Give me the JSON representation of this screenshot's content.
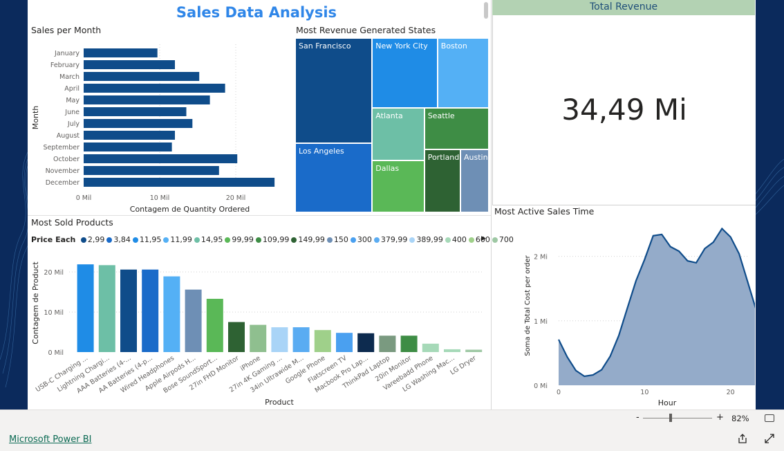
{
  "report": {
    "title": "Sales Data Analysis",
    "colors": {
      "accent": "#2f86e8",
      "canvas": "#0b2a5c",
      "kpi_header": "#b3d2b3"
    }
  },
  "sales_per_month": {
    "title": "Sales per Month",
    "chart_data": {
      "type": "bar",
      "orientation": "horizontal",
      "categories": [
        "January",
        "February",
        "March",
        "April",
        "May",
        "June",
        "July",
        "August",
        "September",
        "October",
        "November",
        "December"
      ],
      "values": [
        9.7,
        12.0,
        15.2,
        18.6,
        16.6,
        13.5,
        14.3,
        12.0,
        11.6,
        20.2,
        17.8,
        25.1
      ],
      "xlabel": "Contagem de Quantity Ordered",
      "ylabel": "Month",
      "xlim": [
        0,
        27
      ],
      "xticks": [
        0,
        10,
        20
      ],
      "xtick_labels": [
        "0 Mil",
        "10 Mil",
        "20 Mil"
      ],
      "color": "#0f4c8a"
    }
  },
  "states": {
    "title": "Most Revenue Generated States",
    "chart_data": {
      "type": "treemap",
      "labels": [
        "San Francisco",
        "Los Angeles",
        "New York City",
        "Boston",
        "Atlanta",
        "Dallas",
        "Seattle",
        "Portland",
        "Austin"
      ],
      "values": [
        8.26,
        5.45,
        4.66,
        3.66,
        2.8,
        2.77,
        2.75,
        2.32,
        1.82
      ],
      "colors": [
        "#0f4c8a",
        "#1a6bc9",
        "#1f8ce6",
        "#54b0f5",
        "#6dbfa6",
        "#5ab857",
        "#3e8d45",
        "#2e6233",
        "#6e8fb5"
      ]
    }
  },
  "kpi": {
    "title": "Total Revenue",
    "value": "34,49 Mi"
  },
  "products": {
    "title": "Most Sold Products",
    "legend": {
      "title": "Price Each",
      "items": [
        {
          "label": "2,99",
          "color": "#0f4c8a"
        },
        {
          "label": "3,84",
          "color": "#1a6bc9"
        },
        {
          "label": "11,95",
          "color": "#1f8ce6"
        },
        {
          "label": "11,99",
          "color": "#54b0f5"
        },
        {
          "label": "14,95",
          "color": "#6dbfa6"
        },
        {
          "label": "99,99",
          "color": "#5ab857"
        },
        {
          "label": "109,99",
          "color": "#3e8d45"
        },
        {
          "label": "149,99",
          "color": "#2e6233"
        },
        {
          "label": "150",
          "color": "#6e8fb5"
        },
        {
          "label": "300",
          "color": "#4aa0f0"
        },
        {
          "label": "379,99",
          "color": "#5aacf2"
        },
        {
          "label": "389,99",
          "color": "#a9d4f7"
        },
        {
          "label": "400",
          "color": "#a6d9b8"
        },
        {
          "label": "600",
          "color": "#9fd08a"
        },
        {
          "label": "700",
          "color": "#9ec8a4"
        }
      ]
    },
    "chart_data": {
      "type": "bar",
      "categories": [
        "USB-C Charging ...",
        "Lightning Chargi...",
        "AAA Batteries (4-...",
        "AA Batteries (4-p...",
        "Wired Headphones",
        "Apple Airpods H...",
        "Bose SoundSport...",
        "27in FHD Monitor",
        "iPhone",
        "27in 4K Gaming ...",
        "34in Ultrawide M...",
        "Google Phone",
        "Flatscreen TV",
        "Macbook Pro Lap...",
        "ThinkPad Laptop",
        "20in Monitor",
        "Vareebadd Phone",
        "LG Washing Mac...",
        "LG Dryer"
      ],
      "values": [
        21.9,
        21.7,
        20.6,
        20.6,
        18.9,
        15.6,
        13.3,
        7.5,
        6.8,
        6.2,
        6.2,
        5.5,
        4.8,
        4.7,
        4.1,
        4.1,
        2.1,
        0.7,
        0.6
      ],
      "colors": [
        "#1f8ce6",
        "#6dbfa6",
        "#0f4c8a",
        "#1a6bc9",
        "#54b0f5",
        "#6e8fb5",
        "#5ab857",
        "#2e6233",
        "#8fbf8f",
        "#a9d4f7",
        "#5aacf2",
        "#9fd08a",
        "#4aa0f0",
        "#0d2b4f",
        "#7a9a80",
        "#3e8d45",
        "#a6d9b8",
        "#a6d9b8",
        "#9ec8a4"
      ],
      "xlabel": "Product",
      "ylabel": "Contagem de Product",
      "ylim": [
        0,
        24
      ],
      "yticks": [
        0,
        10,
        20
      ],
      "ytick_labels": [
        "0 Mil",
        "10 Mil",
        "20 Mil"
      ]
    }
  },
  "sales_time": {
    "title": "Most Active Sales Time",
    "chart_data": {
      "type": "area",
      "x": [
        0,
        1,
        2,
        3,
        4,
        5,
        6,
        7,
        8,
        9,
        10,
        11,
        12,
        13,
        14,
        15,
        16,
        17,
        18,
        19,
        20,
        21,
        22,
        23
      ],
      "y": [
        0.71,
        0.44,
        0.23,
        0.14,
        0.16,
        0.24,
        0.45,
        0.77,
        1.2,
        1.62,
        1.95,
        2.32,
        2.34,
        2.15,
        2.08,
        1.93,
        1.9,
        2.12,
        2.22,
        2.43,
        2.3,
        2.04,
        1.6,
        1.16
      ],
      "xlabel": "Hour",
      "ylabel": "Soma de Total Cost per order",
      "xlim": [
        0,
        23
      ],
      "ylim": [
        0,
        2.5
      ],
      "xticks": [
        0,
        10,
        20
      ],
      "yticks": [
        0,
        1,
        2
      ],
      "ytick_labels": [
        "0 Mi",
        "1 Mi",
        "2 Mi"
      ],
      "fill_color": "#94abc9",
      "line_color": "#0f4c8a"
    }
  },
  "statusbar": {
    "zoom_minus": "-",
    "zoom_plus": "+",
    "zoom_level": "82%"
  },
  "footer": {
    "brand": "Microsoft Power BI"
  }
}
